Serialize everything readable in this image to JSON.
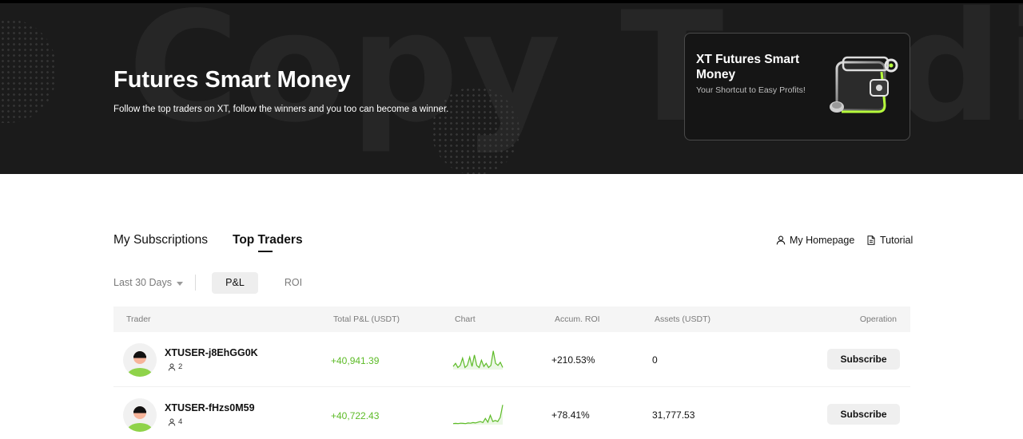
{
  "hero": {
    "watermark": "Copy Trading",
    "title": "Futures Smart Money",
    "subtitle": "Follow the top traders on XT, follow the winners and you too can become a winner."
  },
  "promo": {
    "title": "XT Futures Smart Money",
    "subtitle": "Your Shortcut to Easy Profits!",
    "icon": "wallet-illustration"
  },
  "tabs": [
    {
      "label": "My Subscriptions",
      "active": false
    },
    {
      "label": "Top Traders",
      "active": true
    }
  ],
  "links": {
    "homepage": "My Homepage",
    "tutorial": "Tutorial"
  },
  "filters": {
    "period": "Last 30 Days",
    "metrics": [
      "P&L",
      "ROI"
    ],
    "selected_metric": "P&L"
  },
  "table": {
    "headers": [
      "Trader",
      "Total P&L (USDT)",
      "Chart",
      "Accum. ROI",
      "Assets (USDT)",
      "Operation"
    ],
    "rows": [
      {
        "name": "XTUSER-j8EhGG0K",
        "followers": "2",
        "pnl": "+40,941.39",
        "roi": "+210.53%",
        "assets": "0",
        "action": "Subscribe",
        "spark": [
          0.15,
          0.3,
          0.1,
          0.2,
          0.55,
          0.1,
          0.2,
          0.6,
          0.15,
          0.7,
          0.2,
          0.1,
          0.45,
          0.15,
          0.3,
          0.1,
          0.2,
          0.9,
          0.3,
          0.2,
          0.35,
          0.1
        ]
      },
      {
        "name": "XTUSER-fHzs0M59",
        "followers": "4",
        "pnl": "+40,722.43",
        "roi": "+78.41%",
        "assets": "31,777.53",
        "action": "Subscribe",
        "spark": [
          0.05,
          0.06,
          0.05,
          0.07,
          0.06,
          0.05,
          0.08,
          0.07,
          0.1,
          0.08,
          0.12,
          0.15,
          0.1,
          0.3,
          0.12,
          0.45,
          0.15,
          0.2,
          0.15,
          0.35,
          0.95
        ]
      }
    ]
  },
  "colors": {
    "accent_green": "#5dbb27",
    "hero_bg": "#1b1b1b"
  }
}
